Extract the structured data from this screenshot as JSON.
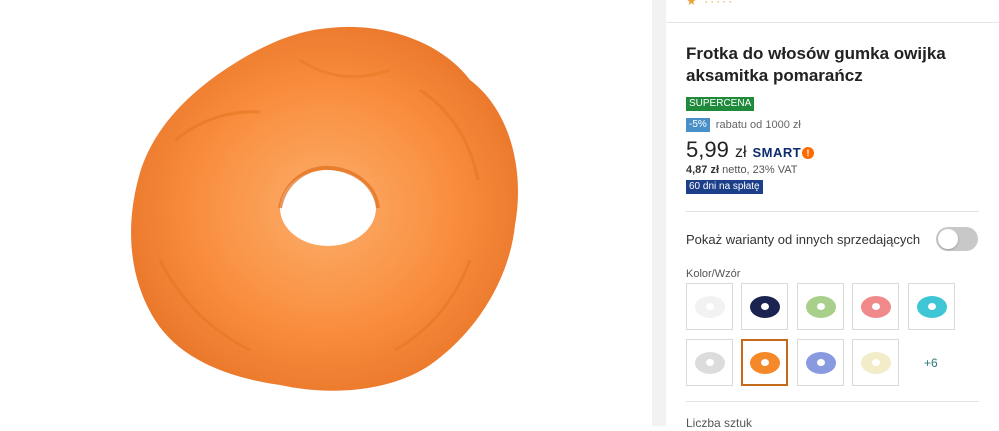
{
  "product": {
    "title": "Frotka do włosów gumka owijka aksamitka pomarańcz",
    "badge_super": "SUPERCENA",
    "discount_badge": "-5%",
    "discount_text": "rabatu od 1000 zł",
    "price_main": "5,99",
    "price_currency": "zł",
    "smart_label": "SMART",
    "netto_value": "4,87 zł",
    "netto_text": "netto, 23% VAT",
    "pay_badge": "60 dni na spłatę"
  },
  "variants": {
    "toggle_label": "Pokaż warianty od innych sprzedających",
    "toggle_on": false,
    "color_label": "Kolor/Wzór",
    "more_label": "+6",
    "swatches": [
      {
        "name": "white",
        "color": "#f2f2f2"
      },
      {
        "name": "navy",
        "color": "#1b2450"
      },
      {
        "name": "light-green",
        "color": "#a8d08a"
      },
      {
        "name": "pink-pattern",
        "color": "#f08a8a"
      },
      {
        "name": "turquoise",
        "color": "#3ec6d6"
      },
      {
        "name": "white-pattern",
        "color": "#dcdcdc"
      },
      {
        "name": "orange",
        "color": "#f5892a",
        "selected": true
      },
      {
        "name": "periwinkle",
        "color": "#8a9ae0"
      },
      {
        "name": "cream",
        "color": "#f3ecc8"
      }
    ]
  },
  "quantity": {
    "label": "Liczba sztuk"
  },
  "colors": {
    "product_orange": "#f98e3e",
    "supercena_green": "#1f8a3b",
    "discount_blue": "#4a90c8",
    "pay_badge_navy": "#1c3f8a",
    "selected_border": "#c46a1a"
  }
}
